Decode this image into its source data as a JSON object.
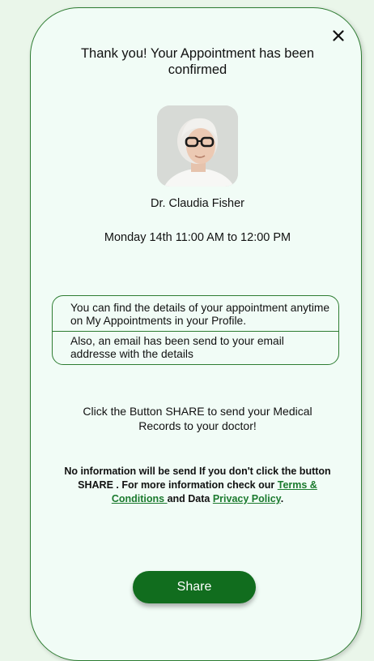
{
  "dialog": {
    "title": "Thank you! Your Appointment has been confirmed",
    "close_icon": "close-icon"
  },
  "doctor": {
    "name": "Dr. Claudia Fisher",
    "avatar": "doctor-photo"
  },
  "appointment": {
    "time": "Monday 14th 11:00 AM to 12:00 PM"
  },
  "info": {
    "line1": "You can find the details of your appointment anytime on My Appointments in your Profile.",
    "line2": "Also, an email has been send to your email addresse with the details"
  },
  "share_prompt": "Click the Button SHARE to send your Medical Records to your doctor!",
  "disclaimer": {
    "text_before": "No information will be send If you don't click the button SHARE . For more information check our ",
    "terms_link": "Terms & Conditions ",
    "text_middle": "and Data ",
    "privacy_link": "Privacy Policy",
    "text_after": "."
  },
  "share_button": {
    "label": "Share"
  },
  "colors": {
    "accent": "#2e7d32",
    "button": "#116d1e",
    "card_bg": "#f1fcf6",
    "page_bg": "#eaf6ea"
  }
}
